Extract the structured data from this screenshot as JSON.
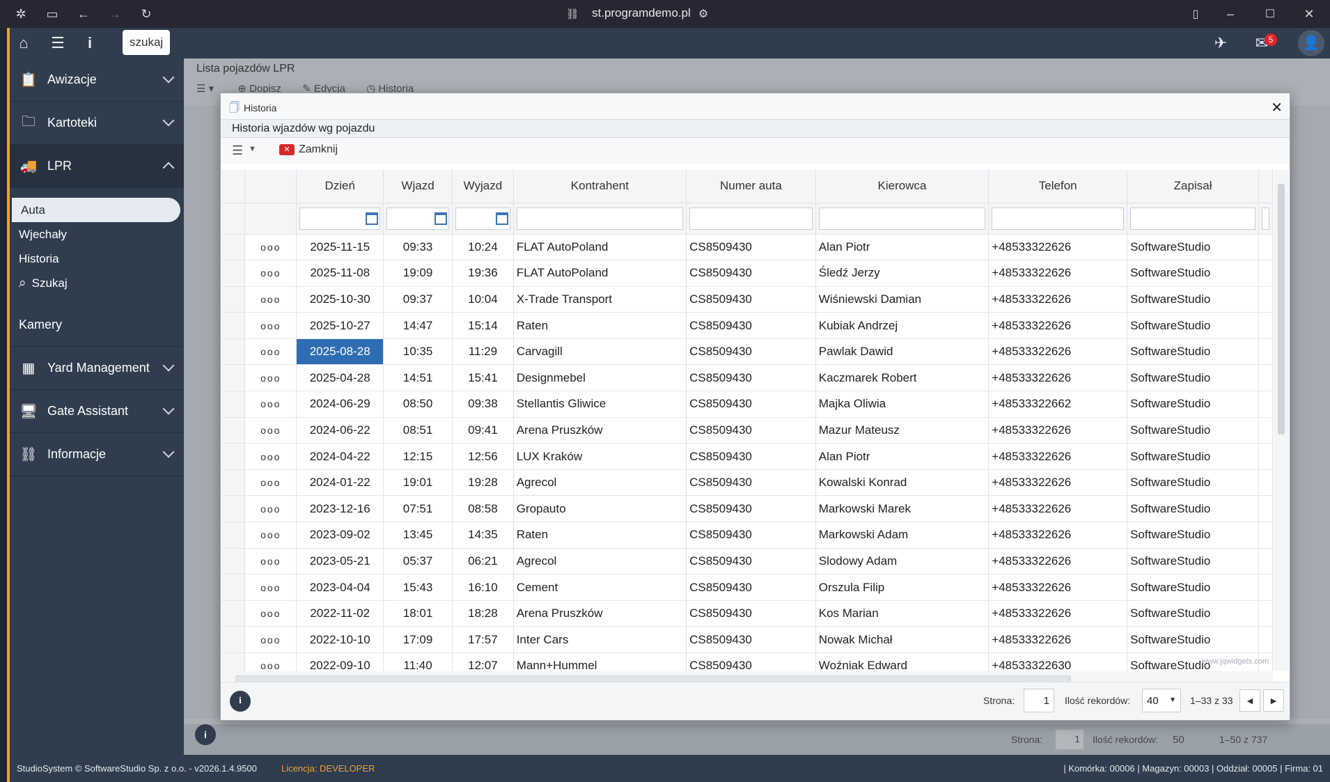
{
  "browser": {
    "url": "st.programdemo.pl"
  },
  "topbar": {
    "search_label": "szukaj",
    "mail_badge": "5"
  },
  "sidebar": {
    "items": [
      {
        "label": "Awizacje"
      },
      {
        "label": "Kartoteki"
      },
      {
        "label": "LPR"
      },
      {
        "label": "Kamery"
      },
      {
        "label": "Yard Management"
      },
      {
        "label": "Gate Assistant"
      },
      {
        "label": "Informacje"
      }
    ],
    "lpr_sub": [
      {
        "label": "Auta"
      },
      {
        "label": "Wjechały"
      },
      {
        "label": "Historia"
      },
      {
        "label": "Szukaj"
      }
    ]
  },
  "background": {
    "title": "Lista pojazdów LPR",
    "toolbar": [
      "Dopisz",
      "Edycja",
      "Historia"
    ],
    "pager": {
      "strona_label": "Strona:",
      "strona_value": "1",
      "ilosc_label": "Ilość rekordów:",
      "ilosc_value": "50",
      "range": "1–50 z 737"
    }
  },
  "dialog": {
    "title": "Historia",
    "subtitle": "Historia wjazdów wg pojazdu",
    "close_label": "Zamknij",
    "columns": [
      "Dzień",
      "Wjazd",
      "Wyjazd",
      "Kontrahent",
      "Numer auta",
      "Kierowca",
      "Telefon",
      "Zapisał"
    ],
    "rows": [
      [
        "2025-11-15",
        "09:33",
        "10:24",
        "FLAT AutoPoland",
        "CS8509430",
        "Alan Piotr",
        "+48533322626",
        "SoftwareStudio"
      ],
      [
        "2025-11-08",
        "19:09",
        "19:36",
        "FLAT AutoPoland",
        "CS8509430",
        "Śledź Jerzy",
        "+48533322626",
        "SoftwareStudio"
      ],
      [
        "2025-10-30",
        "09:37",
        "10:04",
        "X-Trade Transport",
        "CS8509430",
        "Wiśniewski Damian",
        "+48533322626",
        "SoftwareStudio"
      ],
      [
        "2025-10-27",
        "14:47",
        "15:14",
        "Raten",
        "CS8509430",
        "Kubiak Andrzej",
        "+48533322626",
        "SoftwareStudio"
      ],
      [
        "2025-08-28",
        "10:35",
        "11:29",
        "Carvagill",
        "CS8509430",
        "Pawlak Dawid",
        "+48533322626",
        "SoftwareStudio"
      ],
      [
        "2025-04-28",
        "14:51",
        "15:41",
        "Designmebel",
        "CS8509430",
        "Kaczmarek Robert",
        "+48533322626",
        "SoftwareStudio"
      ],
      [
        "2024-06-29",
        "08:50",
        "09:38",
        "Stellantis Gliwice",
        "CS8509430",
        "Majka Oliwia",
        "+48533322662",
        "SoftwareStudio"
      ],
      [
        "2024-06-22",
        "08:51",
        "09:41",
        "Arena Pruszków",
        "CS8509430",
        "Mazur Mateusz",
        "+48533322626",
        "SoftwareStudio"
      ],
      [
        "2024-04-22",
        "12:15",
        "12:56",
        "LUX Kraków",
        "CS8509430",
        "Alan Piotr",
        "+48533322626",
        "SoftwareStudio"
      ],
      [
        "2024-01-22",
        "19:01",
        "19:28",
        "Agrecol",
        "CS8509430",
        "Kowalski Konrad",
        "+48533322626",
        "SoftwareStudio"
      ],
      [
        "2023-12-16",
        "07:51",
        "08:58",
        "Gropauto",
        "CS8509430",
        "Markowski Marek",
        "+48533322626",
        "SoftwareStudio"
      ],
      [
        "2023-09-02",
        "13:45",
        "14:35",
        "Raten",
        "CS8509430",
        "Markowski Adam",
        "+48533322626",
        "SoftwareStudio"
      ],
      [
        "2023-05-21",
        "05:37",
        "06:21",
        "Agrecol",
        "CS8509430",
        "Slodowy Adam",
        "+48533322626",
        "SoftwareStudio"
      ],
      [
        "2023-04-04",
        "15:43",
        "16:10",
        "Cement",
        "CS8509430",
        "Orszula Filip",
        "+48533322626",
        "SoftwareStudio"
      ],
      [
        "2022-11-02",
        "18:01",
        "18:28",
        "Arena Pruszków",
        "CS8509430",
        "Kos Marian",
        "+48533322626",
        "SoftwareStudio"
      ],
      [
        "2022-10-10",
        "17:09",
        "17:57",
        "Inter Cars",
        "CS8509430",
        "Nowak Michał",
        "+48533322626",
        "SoftwareStudio"
      ],
      [
        "2022-09-10",
        "11:40",
        "12:07",
        "Mann+Hummel",
        "CS8509430",
        "Woźniak Edward",
        "+48533322630",
        "SoftwareStudio"
      ]
    ],
    "row_action": "ooo",
    "watermark": "www.jqwidgets.com",
    "pager": {
      "strona_label": "Strona:",
      "strona_value": "1",
      "ilosc_label": "Ilość rekordów:",
      "ilosc_value": "40",
      "range": "1–33 z 33"
    }
  },
  "status": {
    "left": "StudioSystem © SoftwareStudio Sp. z o.o. - v2026.1.4.9500",
    "licencja_label": "Licencja:",
    "licencja_value": "DEVELOPER",
    "right": "| Komórka: 00006 | Magazyn: 00003 | Oddział: 00005 | Firma: 01"
  },
  "colors": {
    "accent": "#2f6db3",
    "sidebar": "#2f3d4e",
    "license": "#f0a030",
    "badge": "#e0242a",
    "close_icon": "#d42a2a"
  }
}
